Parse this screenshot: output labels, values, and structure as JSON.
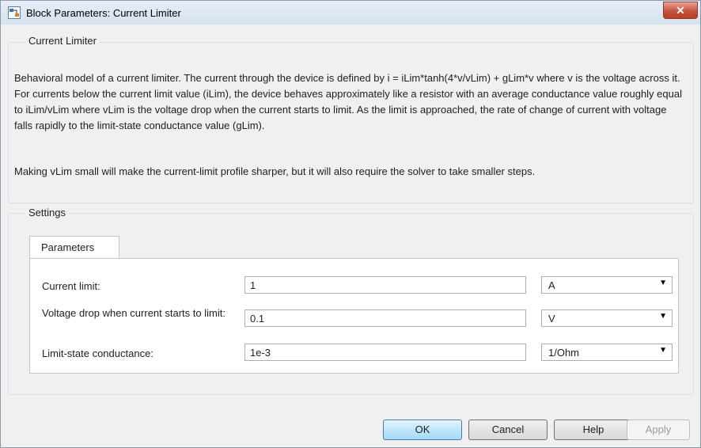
{
  "window": {
    "title": "Block Parameters: Current Limiter",
    "close_label": "✕"
  },
  "block_group": {
    "legend": "Current Limiter",
    "description_1": "Behavioral model of a current limiter. The current through the device is defined by i = iLim*tanh(4*v/vLim) + gLim*v where v is the voltage across it. For currents below the current limit value (iLim), the device behaves approximately like a resistor with an average conductance value roughly equal to iLim/vLim where vLim is the voltage drop when the current starts to limit. As the limit is approached, the rate of change of current with voltage falls rapidly to the limit-state conductance value (gLim).",
    "description_2": "Making vLim small will make the current-limit profile sharper, but it will also require the solver to take smaller steps."
  },
  "settings": {
    "legend": "Settings",
    "tab_label": "Parameters",
    "params": [
      {
        "label": "Current limit:",
        "value": "1",
        "unit": "A"
      },
      {
        "label": "Voltage drop when current starts to limit:",
        "value": "0.1",
        "unit": "V"
      },
      {
        "label": "Limit-state conductance:",
        "value": "1e-3",
        "unit": "1/Ohm"
      }
    ]
  },
  "buttons": {
    "ok": "OK",
    "cancel": "Cancel",
    "help": "Help",
    "apply": "Apply"
  },
  "colors": {
    "titlebar": "#dce6f2",
    "close": "#c7503b",
    "default_button": "#bee6fd"
  }
}
